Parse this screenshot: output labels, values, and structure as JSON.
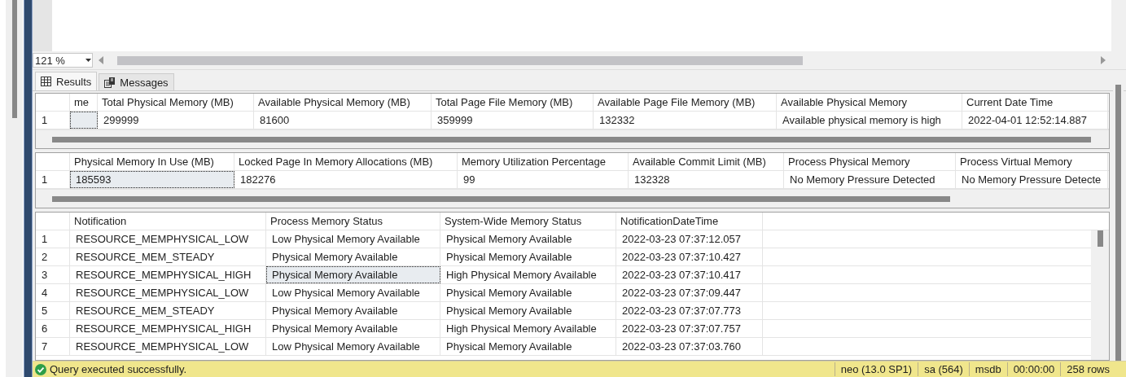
{
  "editor": {
    "zoom": "121 %"
  },
  "tabs": [
    {
      "label": "Results",
      "selected": true,
      "kind": "grid"
    },
    {
      "label": "Messages",
      "selected": false,
      "kind": "messages"
    }
  ],
  "grids": [
    {
      "columns": [
        "me",
        "Total Physical Memory (MB)",
        "Available Physical Memory (MB)",
        "Total Page File Memory (MB)",
        "Available Page File Memory (MB)",
        "Available Physical Memory",
        "Current Date Time"
      ],
      "rows": [
        {
          "number": "1",
          "cells": [
            {
              "selected": true
            },
            {
              "text": "299999",
              "selected": false
            },
            {
              "text": "81600",
              "selected": false
            },
            {
              "text": "359999",
              "selected": false
            },
            {
              "text": "132332",
              "selected": false
            },
            {
              "text": "Available physical memory is high",
              "selected": false
            },
            {
              "text": "2022-04-01 12:52:14.887",
              "selected": false
            }
          ]
        }
      ]
    },
    {
      "columns": [
        "Physical Memory In Use (MB)",
        "Locked Page In Memory Allocations (MB)",
        "Memory Utilization Percentage",
        "Available Commit Limit (MB)",
        "Process Physical Memory",
        "Process Virtual Memory"
      ],
      "rows": [
        {
          "number": "1",
          "cells": [
            {
              "text": "185593",
              "selected": true
            },
            {
              "text": "182276",
              "selected": false
            },
            {
              "text": "99",
              "selected": false
            },
            {
              "text": "132328",
              "selected": false
            },
            {
              "text": "No Memory Pressure Detected",
              "selected": false
            },
            {
              "text": "No Memory Pressure Detecte",
              "selected": false
            }
          ]
        }
      ]
    },
    {
      "columns": [
        "Notification",
        "Process Memory Status",
        "System-Wide Memory Status",
        "NotificationDateTime"
      ],
      "rows": [
        {
          "number": "1",
          "cells": [
            {
              "text": "RESOURCE_MEMPHYSICAL_LOW",
              "selected": false
            },
            {
              "text": "Low Physical Memory Available",
              "selected": false
            },
            {
              "text": "Physical Memory Available",
              "selected": false
            },
            {
              "text": "2022-03-23 07:37:12.057",
              "selected": false
            }
          ]
        },
        {
          "number": "2",
          "cells": [
            {
              "text": "RESOURCE_MEM_STEADY",
              "selected": false
            },
            {
              "text": "Physical Memory Available",
              "selected": false
            },
            {
              "text": "Physical Memory Available",
              "selected": false
            },
            {
              "text": "2022-03-23 07:37:10.427",
              "selected": false
            }
          ]
        },
        {
          "number": "3",
          "cells": [
            {
              "text": "RESOURCE_MEMPHYSICAL_HIGH",
              "selected": false
            },
            {
              "text": "Physical Memory Available",
              "selected": true
            },
            {
              "text": "High Physical Memory Available",
              "selected": false
            },
            {
              "text": "2022-03-23 07:37:10.417",
              "selected": false
            }
          ]
        },
        {
          "number": "4",
          "cells": [
            {
              "text": "RESOURCE_MEMPHYSICAL_LOW",
              "selected": false
            },
            {
              "text": "Low Physical Memory Available",
              "selected": false
            },
            {
              "text": "Physical Memory Available",
              "selected": false
            },
            {
              "text": "2022-03-23 07:37:09.447",
              "selected": false
            }
          ]
        },
        {
          "number": "5",
          "cells": [
            {
              "text": "RESOURCE_MEM_STEADY",
              "selected": false
            },
            {
              "text": "Physical Memory Available",
              "selected": false
            },
            {
              "text": "Physical Memory Available",
              "selected": false
            },
            {
              "text": "2022-03-23 07:37:07.773",
              "selected": false
            }
          ]
        },
        {
          "number": "6",
          "cells": [
            {
              "text": "RESOURCE_MEMPHYSICAL_HIGH",
              "selected": false
            },
            {
              "text": "Physical Memory Available",
              "selected": false
            },
            {
              "text": "High Physical Memory Available",
              "selected": false
            },
            {
              "text": "2022-03-23 07:37:07.757",
              "selected": false
            }
          ]
        },
        {
          "number": "7",
          "cells": [
            {
              "text": "RESOURCE_MEMPHYSICAL_LOW",
              "selected": false
            },
            {
              "text": "Low Physical Memory Available",
              "selected": false
            },
            {
              "text": "Physical Memory Available",
              "selected": false
            },
            {
              "text": "2022-03-23 07:37:03.760",
              "selected": false
            }
          ]
        }
      ]
    }
  ],
  "status_bar": {
    "message": "Query executed successfully.",
    "segments": [
      "neo (13.0 SP1)",
      "sa (564)",
      "msdb",
      "00:00:00",
      "258 rows"
    ]
  }
}
